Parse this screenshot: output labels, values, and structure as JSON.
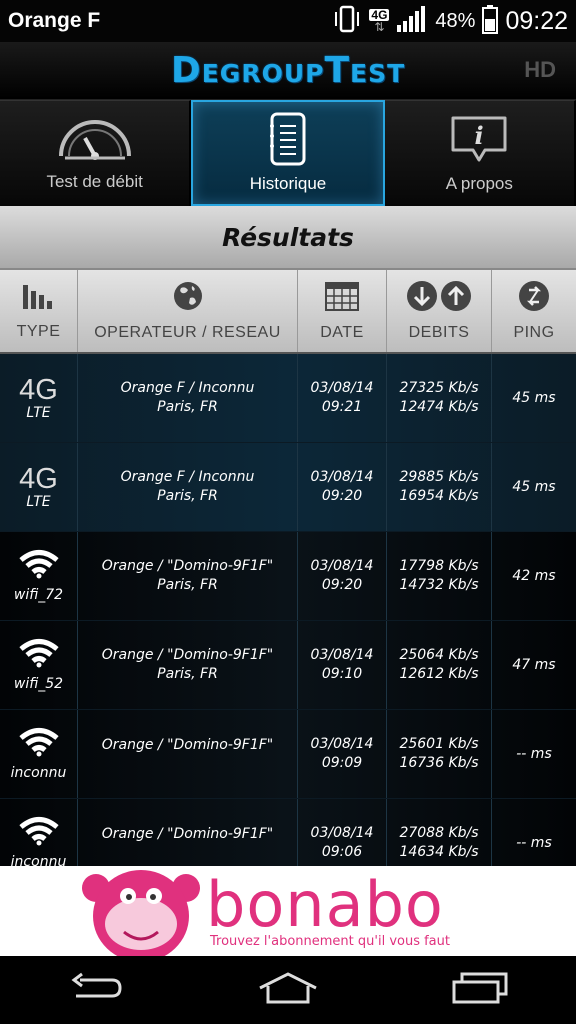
{
  "status_bar": {
    "carrier": "Orange F",
    "network": "4G",
    "battery": "48%",
    "time": "09:22"
  },
  "app": {
    "title": "DegroupTest",
    "hd_badge": "HD"
  },
  "tabs": [
    {
      "label": "Test de débit",
      "icon": "speedometer-icon",
      "active": false
    },
    {
      "label": "Historique",
      "icon": "notepad-icon",
      "active": true
    },
    {
      "label": "A propos",
      "icon": "info-bubble-icon",
      "active": false
    }
  ],
  "results_title": "Résultats",
  "columns": [
    {
      "label": "TYPE",
      "icon": "bar-chart-icon"
    },
    {
      "label": "OPERATEUR / RESEAU",
      "icon": "globe-icon"
    },
    {
      "label": "DATE",
      "icon": "calendar-icon"
    },
    {
      "label": "DEBITS",
      "icon": "down-up-arrows-icon"
    },
    {
      "label": "PING",
      "icon": "ping-icon"
    }
  ],
  "rows": [
    {
      "type_icon": "4G",
      "type_label": "LTE",
      "operator": "Orange F / Inconnu",
      "location": "Paris, FR",
      "date": "03/08/14",
      "time": "09:21",
      "down": "27325 Kb/s",
      "up": "12474 Kb/s",
      "ping": "45 ms"
    },
    {
      "type_icon": "4G",
      "type_label": "LTE",
      "operator": "Orange F / Inconnu",
      "location": "Paris, FR",
      "date": "03/08/14",
      "time": "09:20",
      "down": "29885 Kb/s",
      "up": "16954 Kb/s",
      "ping": "45 ms"
    },
    {
      "type_icon": "wifi",
      "type_label": "wifi_72",
      "operator": "Orange / \"Domino-9F1F\"",
      "location": "Paris, FR",
      "date": "03/08/14",
      "time": "09:20",
      "down": "17798 Kb/s",
      "up": "14732 Kb/s",
      "ping": "42 ms"
    },
    {
      "type_icon": "wifi",
      "type_label": "wifi_52",
      "operator": "Orange / \"Domino-9F1F\"",
      "location": "Paris, FR",
      "date": "03/08/14",
      "time": "09:10",
      "down": "25064 Kb/s",
      "up": "12612 Kb/s",
      "ping": "47 ms"
    },
    {
      "type_icon": "wifi",
      "type_label": "inconnu",
      "operator": "Orange / \"Domino-9F1F\"",
      "location": "",
      "date": "03/08/14",
      "time": "09:09",
      "down": "25601 Kb/s",
      "up": "16736 Kb/s",
      "ping": "-- ms"
    },
    {
      "type_icon": "wifi",
      "type_label": "inconnu",
      "operator": "Orange / \"Domino-9F1F\"",
      "location": "",
      "date": "03/08/14",
      "time": "09:06",
      "down": "27088 Kb/s",
      "up": "14634 Kb/s",
      "ping": "-- ms"
    }
  ],
  "ad": {
    "brand": "bonabo",
    "tagline": "Trouvez l'abonnement qu'il vous faut"
  },
  "colors": {
    "accent": "#29a6e0",
    "ad_pink": "#e0317e"
  }
}
